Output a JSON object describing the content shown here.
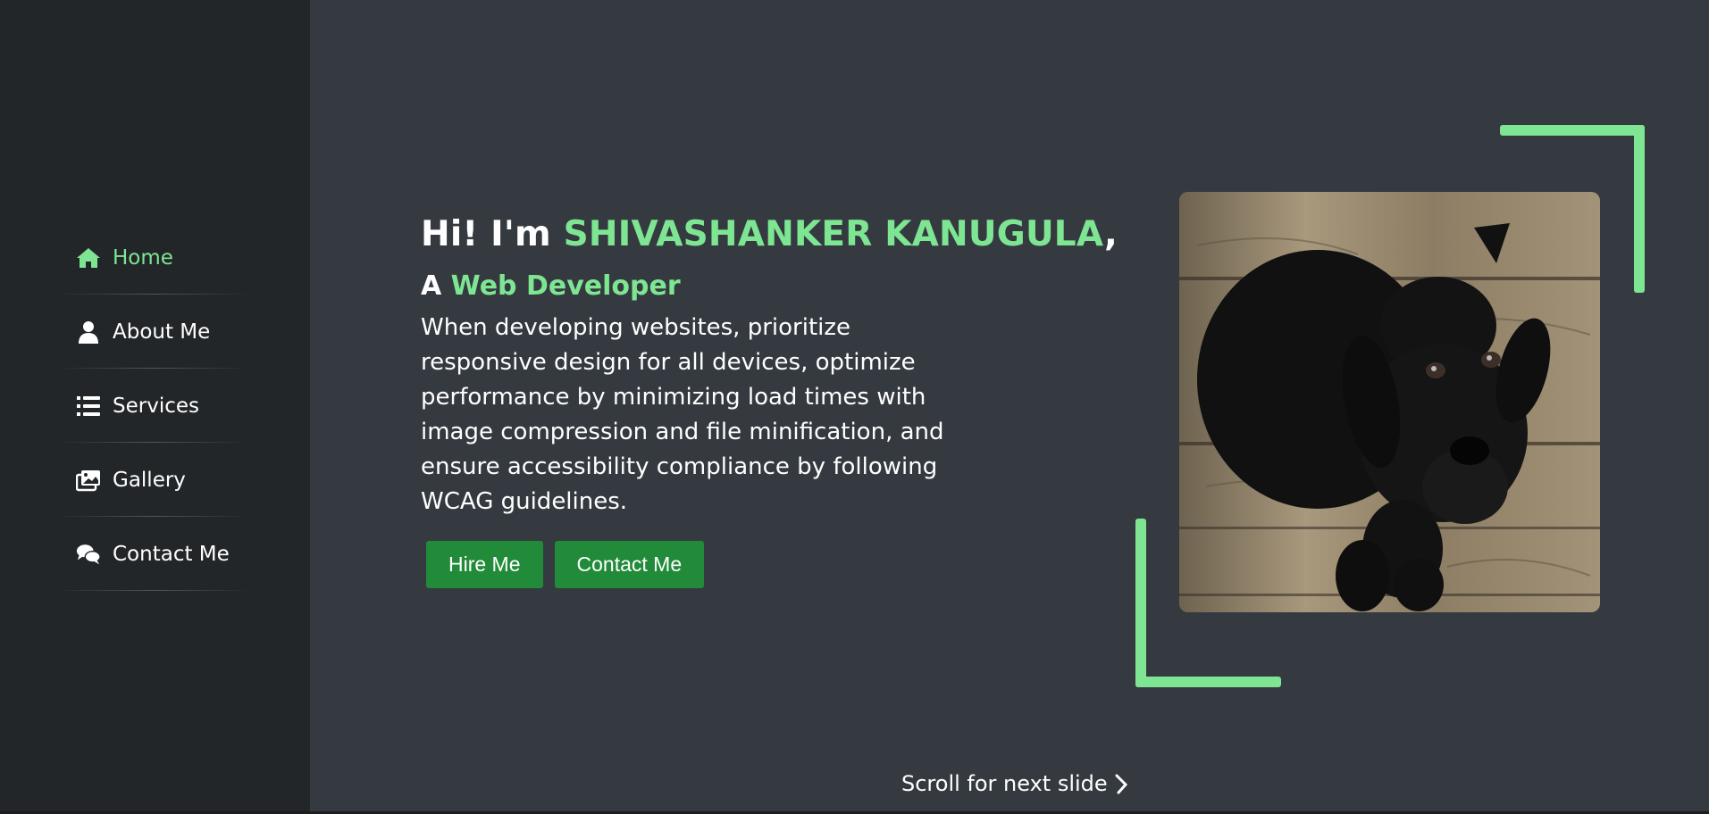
{
  "nav": {
    "items": [
      {
        "label": "Home",
        "icon": "home-icon",
        "active": true
      },
      {
        "label": "About Me",
        "icon": "user-icon",
        "active": false
      },
      {
        "label": "Services",
        "icon": "list-icon",
        "active": false
      },
      {
        "label": "Gallery",
        "icon": "images-icon",
        "active": false
      },
      {
        "label": "Contact Me",
        "icon": "comments-icon",
        "active": false
      }
    ]
  },
  "hero": {
    "greeting": "Hi! I'm ",
    "name": "SHIVASHANKER KANUGULA",
    "name_suffix": ",",
    "role_prefix": "A ",
    "role": "Web Developer",
    "description": "When developing websites, prioritize responsive design for all devices, optimize performance by minimizing load times with image compression and file minification, and ensure accessibility compliance by following WCAG guidelines.",
    "hire_button": "Hire Me",
    "contact_button": "Contact Me"
  },
  "scroll_hint": {
    "label": "Scroll for next slide"
  },
  "colors": {
    "accent": "#7ee592",
    "button": "#218b3a",
    "sidebar": "#232629",
    "background": "#353a41"
  }
}
